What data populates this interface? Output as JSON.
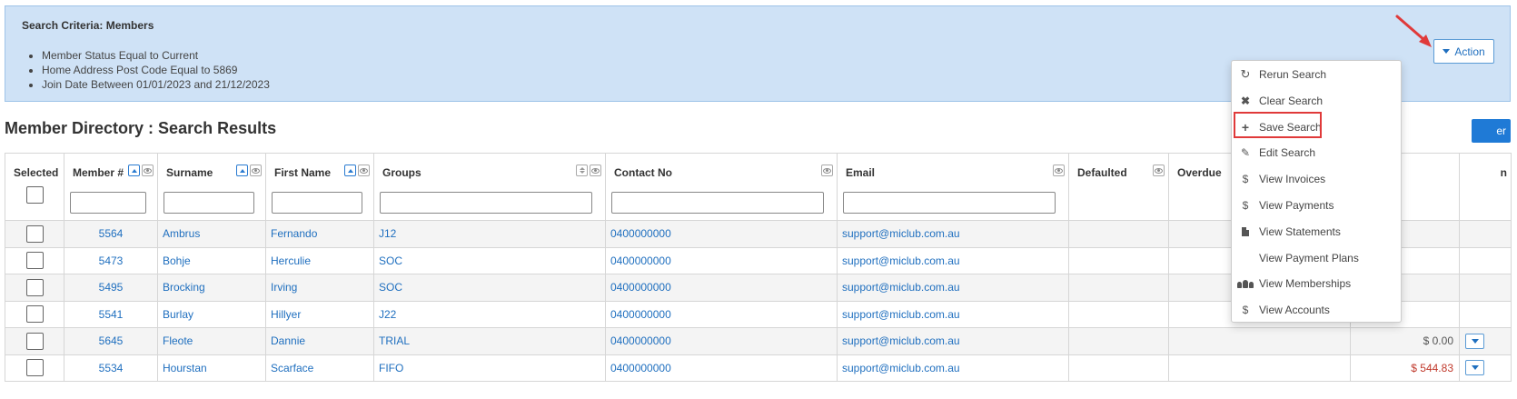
{
  "criteria": {
    "title": "Search Criteria: Members",
    "items": [
      "Member Status Equal to Current",
      "Home Address Post Code Equal to 5869",
      "Join Date Between 01/01/2023 and 21/12/2023"
    ],
    "action_label": "Action"
  },
  "page_title": "Member Directory : Search Results",
  "partial_button_label": "er",
  "columns": {
    "selected": "Selected",
    "member": "Member #",
    "surname": "Surname",
    "first_name": "First Name",
    "groups": "Groups",
    "contact": "Contact No",
    "email": "Email",
    "defaulted": "Defaulted",
    "overdue": "Overdue",
    "last": "n"
  },
  "rows": [
    {
      "member": "5564",
      "surname": "Ambrus",
      "first": "Fernando",
      "group": "J12",
      "contact": "0400000000",
      "email": "support@miclub.com.au",
      "amount": ""
    },
    {
      "member": "5473",
      "surname": "Bohje",
      "first": "Herculie",
      "group": "SOC",
      "contact": "0400000000",
      "email": "support@miclub.com.au",
      "amount": ""
    },
    {
      "member": "5495",
      "surname": "Brocking",
      "first": "Irving",
      "group": "SOC",
      "contact": "0400000000",
      "email": "support@miclub.com.au",
      "amount": ""
    },
    {
      "member": "5541",
      "surname": "Burlay",
      "first": "Hillyer",
      "group": "J22",
      "contact": "0400000000",
      "email": "support@miclub.com.au",
      "amount": ""
    },
    {
      "member": "5645",
      "surname": "Fleote",
      "first": "Dannie",
      "group": "TRIAL",
      "contact": "0400000000",
      "email": "support@miclub.com.au",
      "amount": "$ 0.00"
    },
    {
      "member": "5534",
      "surname": "Hourstan",
      "first": "Scarface",
      "group": "FIFO",
      "contact": "0400000000",
      "email": "support@miclub.com.au",
      "amount": "$ 544.83"
    }
  ],
  "menu": {
    "items": [
      {
        "label": "Rerun Search",
        "icon": "refresh-icon"
      },
      {
        "label": "Clear Search",
        "icon": "close-icon"
      },
      {
        "label": "Save Search",
        "icon": "plus-icon"
      },
      {
        "label": "Edit Search",
        "icon": "pencil-icon"
      },
      {
        "label": "View Invoices",
        "icon": "dollar-icon"
      },
      {
        "label": "View Payments",
        "icon": "dollar-icon"
      },
      {
        "label": "View Statements",
        "icon": "document-icon"
      },
      {
        "label": "View Payment Plans",
        "icon": ""
      },
      {
        "label": "View Memberships",
        "icon": "users-icon"
      },
      {
        "label": "View Accounts",
        "icon": "dollar-icon"
      }
    ]
  },
  "colors": {
    "link": "#1f6fbf",
    "criteria_bg": "#cfe2f6",
    "highlight": "#e03a3a",
    "amount_negative": "#c0392b"
  }
}
